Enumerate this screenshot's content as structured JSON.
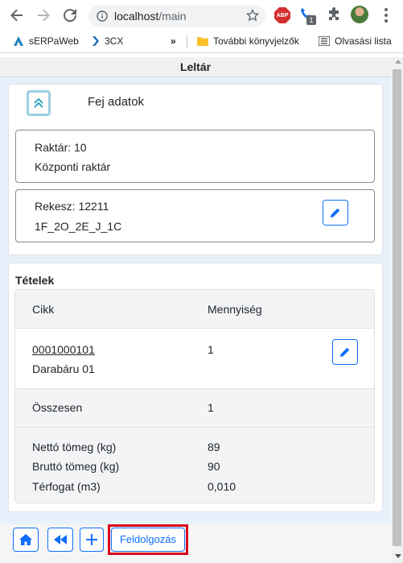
{
  "browser": {
    "url_host": "localhost",
    "url_path": "/main",
    "ext_badge": "1",
    "abp_label": "ABP",
    "bookmarks": [
      {
        "label": "sERPaWeb"
      },
      {
        "label": "3CX"
      },
      {
        "label": "»"
      },
      {
        "label": "További könyvjelzők"
      },
      {
        "label": "Olvasási lista"
      }
    ]
  },
  "app": {
    "title": "Leltár",
    "header_section": {
      "label": "Fej adatok",
      "warehouse_line1": "Raktár: 10",
      "warehouse_line2": "Központi raktár",
      "bin_line1": "Rekesz: 12211",
      "bin_line2": "1F_2O_2E_J_1C"
    },
    "items_section": {
      "title": "Tételek",
      "col_item": "Cikk",
      "col_qty": "Mennyiség",
      "rows": [
        {
          "code": "0001000101",
          "name": "Darabáru 01",
          "qty": "1"
        }
      ],
      "total_label": "Összesen",
      "total_value": "1",
      "net_label": "Nettó tömeg (kg)",
      "net_value": "89",
      "gross_label": "Bruttó tömeg (kg)",
      "gross_value": "90",
      "volume_label": "Térfogat (m3)",
      "volume_value": "0,010"
    },
    "bottom": {
      "process_label": "Feldolgozás"
    }
  },
  "colors": {
    "accent": "#0d6efd",
    "highlight": "#d6001c",
    "content_bg": "#e7f1fb"
  }
}
